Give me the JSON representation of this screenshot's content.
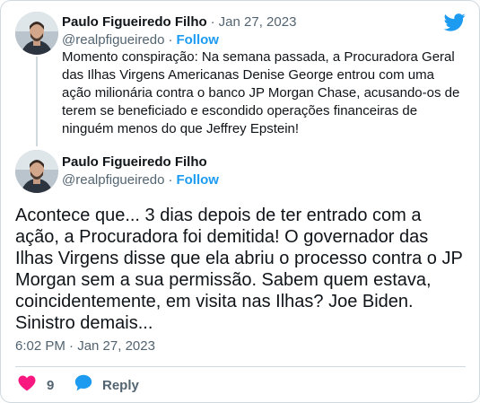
{
  "colors": {
    "accent": "#1d9bf0",
    "heart": "#f91880",
    "muted": "#536471",
    "text": "#0f1419",
    "border": "#cfd9de"
  },
  "quoted_tweet": {
    "author_name": "Paulo Figueiredo Filho",
    "separator": "·",
    "date": "Jan 27, 2023",
    "handle": "@realpfigueiredo",
    "follow_separator": "·",
    "follow_label": "Follow",
    "text": "Momento conspiração: Na semana passada, a Procuradora Geral das Ilhas Virgens Americanas Denise George entrou com uma ação milionária contra o banco JP Morgan Chase, acusando-os de terem se beneficiado e escondido operações financeiras de ninguém menos do que Jeffrey Epstein!"
  },
  "main_tweet": {
    "author_name": "Paulo Figueiredo Filho",
    "handle": "@realpfigueiredo",
    "follow_separator": "·",
    "follow_label": "Follow",
    "text": "Acontece que... 3 dias depois de ter entrado com a ação, a Procuradora foi demitida! O governador das Ilhas Virgens disse que ela abriu o processo contra o JP Morgan sem a sua permissão. Sabem quem estava, coincidentemente, em visita nas Ilhas? Joe Biden. Sinistro demais...",
    "timestamp": "6:02 PM · Jan 27, 2023"
  },
  "actions": {
    "like_count": "9",
    "reply_label": "Reply"
  },
  "icons": {
    "logo": "twitter-bird-icon",
    "like": "heart-icon",
    "reply": "speech-bubble-icon"
  }
}
